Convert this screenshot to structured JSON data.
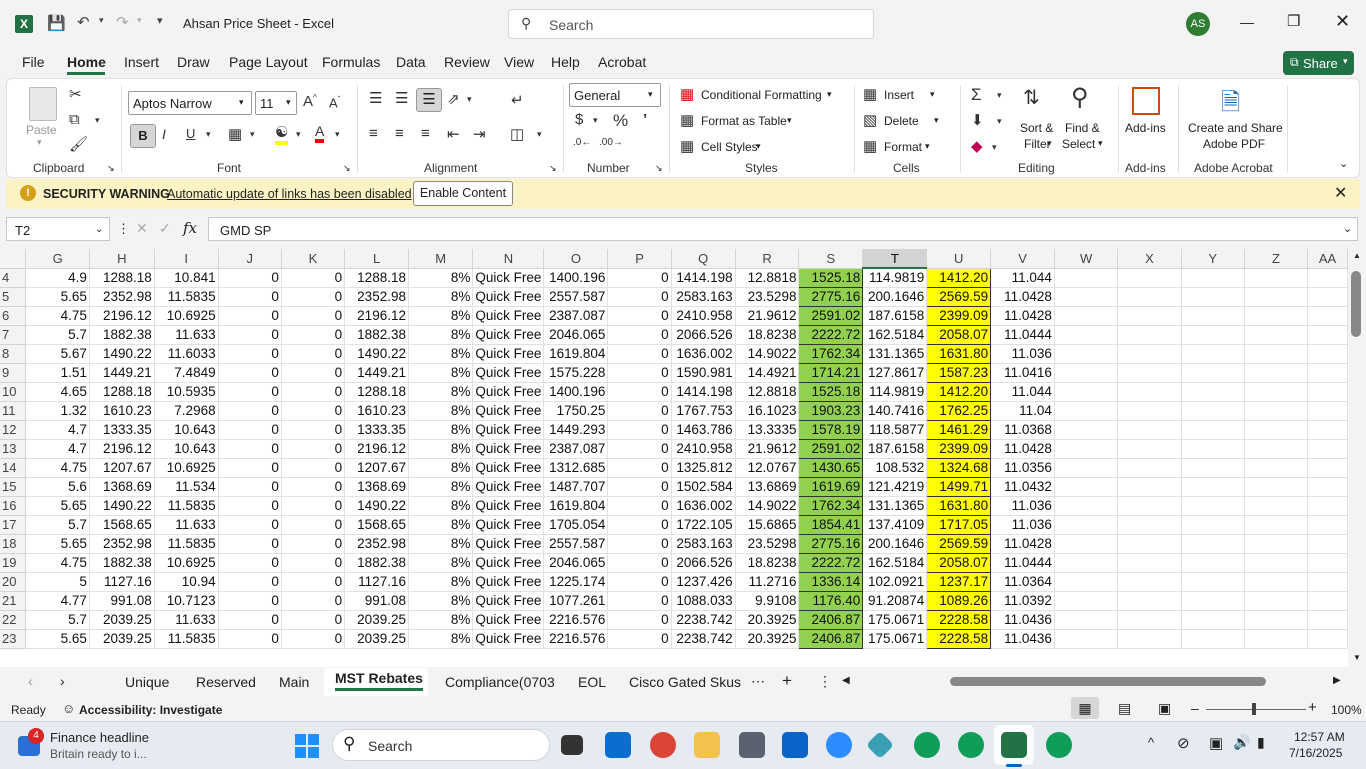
{
  "title_bar": {
    "title": "Ahsan Price Sheet  -  Excel",
    "search_placeholder": "Search",
    "avatar": "AS"
  },
  "menu": [
    "File",
    "Home",
    "Insert",
    "Draw",
    "Page Layout",
    "Formulas",
    "Data",
    "Review",
    "View",
    "Help",
    "Acrobat"
  ],
  "share_label": "Share",
  "ribbon": {
    "paste": "Paste",
    "font_name": "Aptos Narrow",
    "font_size": "11",
    "number_format": "General",
    "conditional_formatting": "Conditional Formatting",
    "format_as_table": "Format as Table",
    "cell_styles": "Cell Styles",
    "insert": "Insert",
    "delete": "Delete",
    "format": "Format",
    "sort_filter_1": "Sort &",
    "sort_filter_2": "Filter",
    "find_select_1": "Find &",
    "find_select_2": "Select",
    "addins": "Add-ins",
    "create_share_1": "Create and Share",
    "create_share_2": "Adobe PDF",
    "groups": {
      "clipboard": "Clipboard",
      "font": "Font",
      "alignment": "Alignment",
      "number": "Number",
      "styles": "Styles",
      "cells": "Cells",
      "editing": "Editing",
      "addins": "Add-ins",
      "acrobat": "Adobe Acrobat"
    }
  },
  "warning": {
    "title": "SECURITY WARNING",
    "message": "Automatic update of links has been disabled",
    "button": "Enable Content"
  },
  "formula_bar": {
    "name_box": "T2",
    "fx": "fx",
    "content": "GMD SP"
  },
  "columns": [
    "G",
    "H",
    "I",
    "J",
    "K",
    "L",
    "M",
    "N",
    "O",
    "P",
    "Q",
    "R",
    "S",
    "T",
    "U",
    "V",
    "W",
    "X",
    "Y",
    "Z",
    "AA"
  ],
  "rows": [
    [
      "4",
      "4.9",
      "1288.18",
      "10.841",
      "0",
      "0",
      "1288.18",
      "8%",
      "Quick Free",
      "1400.196",
      "0",
      "1414.198",
      "12.8818",
      "1525.18",
      "114.9819",
      "1412.20",
      "11.044"
    ],
    [
      "5",
      "5.65",
      "2352.98",
      "11.5835",
      "0",
      "0",
      "2352.98",
      "8%",
      "Quick Free",
      "2557.587",
      "0",
      "2583.163",
      "23.5298",
      "2775.16",
      "200.1646",
      "2569.59",
      "11.0428"
    ],
    [
      "6",
      "4.75",
      "2196.12",
      "10.6925",
      "0",
      "0",
      "2196.12",
      "8%",
      "Quick Free",
      "2387.087",
      "0",
      "2410.958",
      "21.9612",
      "2591.02",
      "187.6158",
      "2399.09",
      "11.0428"
    ],
    [
      "7",
      "5.7",
      "1882.38",
      "11.633",
      "0",
      "0",
      "1882.38",
      "8%",
      "Quick Free",
      "2046.065",
      "0",
      "2066.526",
      "18.8238",
      "2222.72",
      "162.5184",
      "2058.07",
      "11.0444"
    ],
    [
      "8",
      "5.67",
      "1490.22",
      "11.6033",
      "0",
      "0",
      "1490.22",
      "8%",
      "Quick Free",
      "1619.804",
      "0",
      "1636.002",
      "14.9022",
      "1762.34",
      "131.1365",
      "1631.80",
      "11.036"
    ],
    [
      "9",
      "1.51",
      "1449.21",
      "7.4849",
      "0",
      "0",
      "1449.21",
      "8%",
      "Quick Free",
      "1575.228",
      "0",
      "1590.981",
      "14.4921",
      "1714.21",
      "127.8617",
      "1587.23",
      "11.0416"
    ],
    [
      "10",
      "4.65",
      "1288.18",
      "10.5935",
      "0",
      "0",
      "1288.18",
      "8%",
      "Quick Free",
      "1400.196",
      "0",
      "1414.198",
      "12.8818",
      "1525.18",
      "114.9819",
      "1412.20",
      "11.044"
    ],
    [
      "11",
      "1.32",
      "1610.23",
      "7.2968",
      "0",
      "0",
      "1610.23",
      "8%",
      "Quick Free",
      "1750.25",
      "0",
      "1767.753",
      "16.1023",
      "1903.23",
      "140.7416",
      "1762.25",
      "11.04"
    ],
    [
      "12",
      "4.7",
      "1333.35",
      "10.643",
      "0",
      "0",
      "1333.35",
      "8%",
      "Quick Free",
      "1449.293",
      "0",
      "1463.786",
      "13.3335",
      "1578.19",
      "118.5877",
      "1461.29",
      "11.0368"
    ],
    [
      "13",
      "4.7",
      "2196.12",
      "10.643",
      "0",
      "0",
      "2196.12",
      "8%",
      "Quick Free",
      "2387.087",
      "0",
      "2410.958",
      "21.9612",
      "2591.02",
      "187.6158",
      "2399.09",
      "11.0428"
    ],
    [
      "14",
      "4.75",
      "1207.67",
      "10.6925",
      "0",
      "0",
      "1207.67",
      "8%",
      "Quick Free",
      "1312.685",
      "0",
      "1325.812",
      "12.0767",
      "1430.65",
      "108.532",
      "1324.68",
      "11.0356"
    ],
    [
      "15",
      "5.6",
      "1368.69",
      "11.534",
      "0",
      "0",
      "1368.69",
      "8%",
      "Quick Free",
      "1487.707",
      "0",
      "1502.584",
      "13.6869",
      "1619.69",
      "121.4219",
      "1499.71",
      "11.0432"
    ],
    [
      "16",
      "5.65",
      "1490.22",
      "11.5835",
      "0",
      "0",
      "1490.22",
      "8%",
      "Quick Free",
      "1619.804",
      "0",
      "1636.002",
      "14.9022",
      "1762.34",
      "131.1365",
      "1631.80",
      "11.036"
    ],
    [
      "17",
      "5.7",
      "1568.65",
      "11.633",
      "0",
      "0",
      "1568.65",
      "8%",
      "Quick Free",
      "1705.054",
      "0",
      "1722.105",
      "15.6865",
      "1854.41",
      "137.4109",
      "1717.05",
      "11.036"
    ],
    [
      "18",
      "5.65",
      "2352.98",
      "11.5835",
      "0",
      "0",
      "2352.98",
      "8%",
      "Quick Free",
      "2557.587",
      "0",
      "2583.163",
      "23.5298",
      "2775.16",
      "200.1646",
      "2569.59",
      "11.0428"
    ],
    [
      "19",
      "4.75",
      "1882.38",
      "10.6925",
      "0",
      "0",
      "1882.38",
      "8%",
      "Quick Free",
      "2046.065",
      "0",
      "2066.526",
      "18.8238",
      "2222.72",
      "162.5184",
      "2058.07",
      "11.0444"
    ],
    [
      "20",
      "5",
      "1127.16",
      "10.94",
      "0",
      "0",
      "1127.16",
      "8%",
      "Quick Free",
      "1225.174",
      "0",
      "1237.426",
      "11.2716",
      "1336.14",
      "102.0921",
      "1237.17",
      "11.0364"
    ],
    [
      "21",
      "4.77",
      "991.08",
      "10.7123",
      "0",
      "0",
      "991.08",
      "8%",
      "Quick Free",
      "1077.261",
      "0",
      "1088.033",
      "9.9108",
      "1176.40",
      "91.20874",
      "1089.26",
      "11.0392"
    ],
    [
      "22",
      "5.7",
      "2039.25",
      "11.633",
      "0",
      "0",
      "2039.25",
      "8%",
      "Quick Free",
      "2216.576",
      "0",
      "2238.742",
      "20.3925",
      "2406.87",
      "175.0671",
      "2228.58",
      "11.0436"
    ],
    [
      "23",
      "5.65",
      "2039.25",
      "11.5835",
      "0",
      "0",
      "2039.25",
      "8%",
      "Quick Free",
      "2216.576",
      "0",
      "2238.742",
      "20.3925",
      "2406.87",
      "175.0671",
      "2228.58",
      "11.0436"
    ]
  ],
  "sheet_tabs": [
    "Unique",
    "Reserved",
    "Main",
    "MST Rebates",
    "Compliance(0703",
    "EOL",
    "Cisco Gated Skus"
  ],
  "active_sheet": "MST Rebates",
  "status": {
    "ready": "Ready",
    "accessibility": "Accessibility: Investigate",
    "zoom": "100%"
  },
  "taskbar": {
    "news_title": "Finance headline",
    "news_sub": "Britain ready to i...",
    "news_badge": "4",
    "search": "Search",
    "time": "12:57 AM",
    "date": "7/16/2025"
  },
  "colors": {
    "excel_green": "#217346",
    "highlight_green": "#92d050",
    "highlight_yellow": "#ffff00",
    "warning_bg": "#fcf3c4"
  }
}
